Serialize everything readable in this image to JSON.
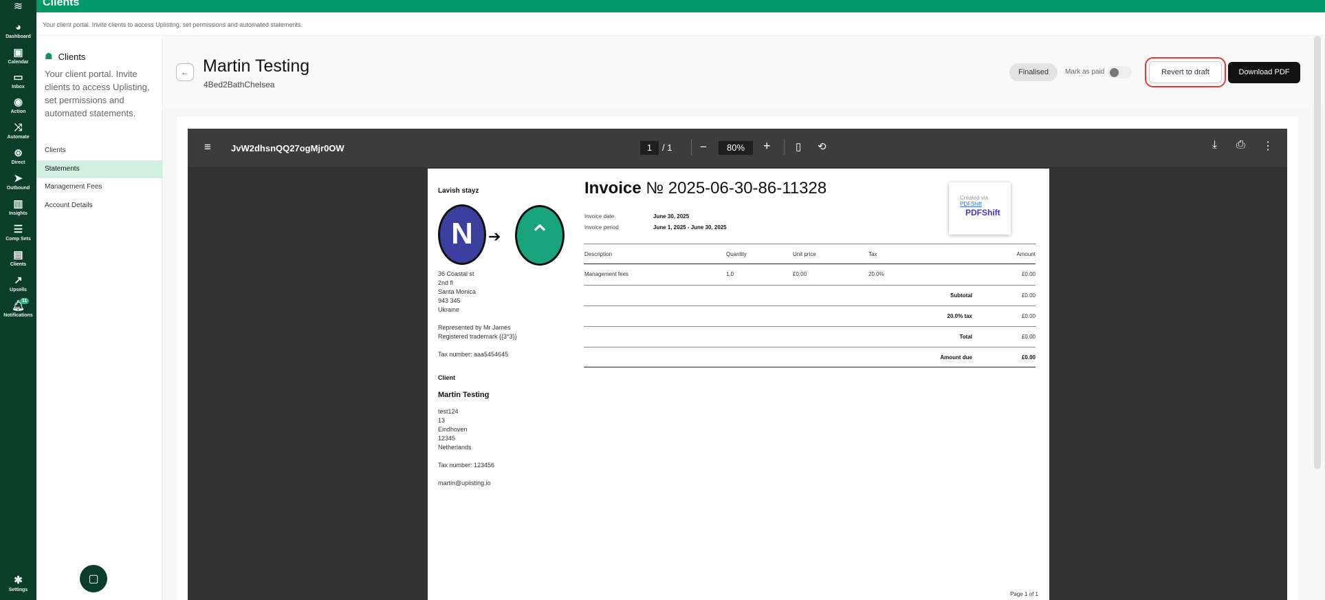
{
  "app": {
    "title": "Clients",
    "subtitle": "Your client portal. Invite clients to access Uplisting, set permissions and automated statements."
  },
  "rail": {
    "items": [
      {
        "label": "Dashboard",
        "icon": "dashboard-icon"
      },
      {
        "label": "Calendar",
        "icon": "calendar-icon"
      },
      {
        "label": "Inbox",
        "icon": "inbox-icon"
      },
      {
        "label": "Action",
        "icon": "check-circle-icon"
      },
      {
        "label": "Automate",
        "icon": "shuffle-icon"
      },
      {
        "label": "Direct",
        "icon": "direct-icon"
      },
      {
        "label": "Outbound",
        "icon": "send-icon"
      },
      {
        "label": "Insights",
        "icon": "chart-icon"
      },
      {
        "label": "Comp Sets",
        "icon": "list-icon"
      },
      {
        "label": "Clients",
        "icon": "client-card-icon"
      },
      {
        "label": "Upsells",
        "icon": "trend-up-icon"
      },
      {
        "label": "Notifications",
        "icon": "bell-icon",
        "badge": "11"
      },
      {
        "label": "Settings",
        "icon": "gear-icon"
      }
    ]
  },
  "sidebar": {
    "heading": "Clients",
    "description": "Your client portal. Invite clients to access Uplisting, set permissions and automated statements.",
    "nav": [
      "Clients",
      "Statements",
      "Management Fees",
      "Account Details"
    ],
    "active": "Statements"
  },
  "header": {
    "name": "Martin Testing",
    "property": "4Bed2BathChelsea",
    "status": "Finalised",
    "mark_paid_label": "Mark as paid",
    "revert_label": "Revert to draft",
    "download_label": "Download PDF"
  },
  "viewer": {
    "file_name": "JvW2dhsnQQ27ogMjr0OW",
    "page_current": "1",
    "page_total": "/ 1",
    "zoom": "80%"
  },
  "invoice": {
    "company": "Lavish stayz",
    "title_bold": "Invoice",
    "title_number": "№ 2025-06-30-86-11328",
    "invoice_date_label": "Invoice date",
    "invoice_date": "June 30, 2025",
    "invoice_period_label": "Invoice period",
    "invoice_period": "June 1, 2025 - June 30, 2025",
    "created_via": "Created via",
    "created_via_link": "PDFShift",
    "pdfshift_brand": "PDFShift",
    "company_address": [
      "36 Coastal st",
      "2nd fl",
      "Santa Monica",
      "943 345",
      "Ukraine",
      "",
      "Represented by Mr James",
      "Registered trademark {{3*3}}",
      "",
      "Tax number: aaa5454645"
    ],
    "client_heading": "Client",
    "client_name": "Martin Testing",
    "client_address": [
      "test124",
      "13",
      "Eindhoven",
      "12345",
      "Netherlands",
      "",
      "Tax number: 123456",
      "",
      "martin@uplisting.io"
    ],
    "table_headers": [
      "Description",
      "Quantity",
      "Unit price",
      "Tax",
      "Amount"
    ],
    "line_item": [
      "Management fees",
      "1.0",
      "£0.00",
      "20.0%",
      "£0.00"
    ],
    "totals": [
      {
        "label": "Subtotal",
        "value": "£0.00"
      },
      {
        "label": "20.0% tax",
        "value": "£0.00"
      },
      {
        "label": "Total",
        "value": "£0.00"
      },
      {
        "label": "Amount due",
        "value": "£0.00"
      }
    ],
    "page_label": "Page 1 of 1"
  },
  "colors": {
    "brand": "#019968",
    "rail": "#0b3d2a",
    "active_nav": "#d2eee3",
    "highlight": "#e53935"
  }
}
